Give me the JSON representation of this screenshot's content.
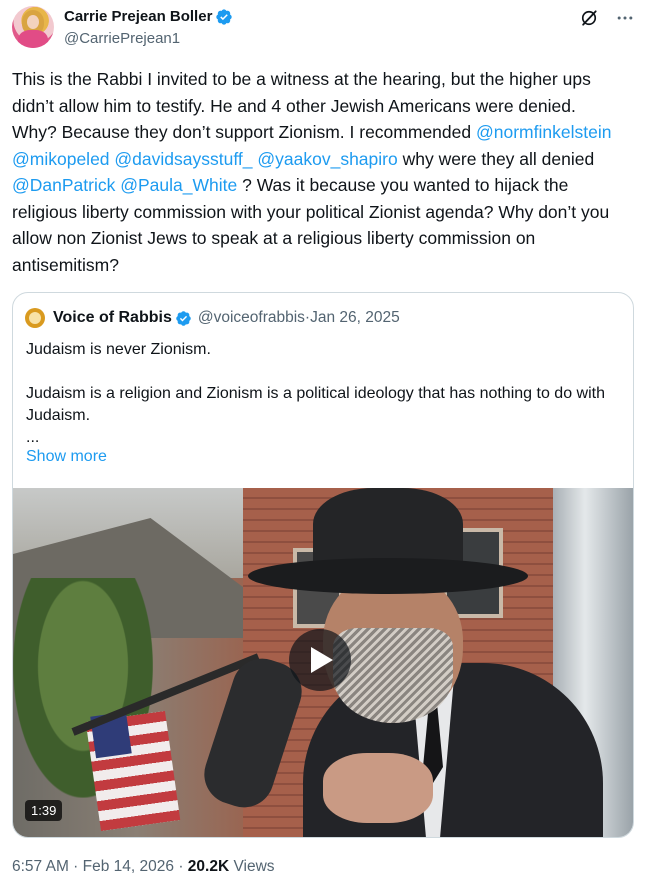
{
  "author": {
    "display_name": "Carrie Prejean Boller",
    "handle": "@CarriePrejean1",
    "verified": true,
    "avatar_icon": "profile-photo"
  },
  "top_actions": [
    {
      "name": "grok-icon"
    },
    {
      "name": "more-icon"
    }
  ],
  "tweet": {
    "text_parts": [
      {
        "text": "This is the Rabbi I invited to be a witness at the hearing, but the higher ups didn’t allow him to testify. He and 4 other Jewish Americans were denied. Why? Because they don’t support Zionism. I recommended ",
        "type": "text"
      },
      {
        "text": "@normfinkelstein",
        "type": "mention"
      },
      {
        "text": " ",
        "type": "text"
      },
      {
        "text": "@mikopeled",
        "type": "mention"
      },
      {
        "text": " ",
        "type": "text"
      },
      {
        "text": "@davidsaysstuff_",
        "type": "mention"
      },
      {
        "text": " ",
        "type": "text"
      },
      {
        "text": "@yaakov_shapiro",
        "type": "mention"
      },
      {
        "text": " why were they all denied ",
        "type": "text"
      },
      {
        "text": "@DanPatrick",
        "type": "mention"
      },
      {
        "text": " ",
        "type": "text"
      },
      {
        "text": "@Paula_White",
        "type": "mention"
      },
      {
        "text": " ? Was it because you wanted to hijack the religious liberty commission with your political Zionist agenda? Why don’t you allow non Zionist Jews to speak at a religious liberty commission on antisemitism?",
        "type": "text"
      }
    ]
  },
  "quote": {
    "display_name": "Voice of Rabbis",
    "handle": "@voiceofrabbis",
    "separator": " · ",
    "date": "Jan 26, 2025",
    "verified": true,
    "text": "Judaism is never Zionism.\n\nJudaism is a religion and Zionism is a political ideology that has nothing to do with Judaism.\n...",
    "show_more": "Show more",
    "video": {
      "duration": "1:39",
      "play_icon": "play-icon"
    }
  },
  "footer": {
    "time": "6:57 AM",
    "separator": " · ",
    "date": "Feb 14, 2026",
    "views_count": "20.2K",
    "views_label": "Views"
  },
  "colors": {
    "text": "#0f1419",
    "secondary": "#536471",
    "link": "#1d9bf0",
    "verified": "#1d9bf0",
    "border": "#cfd9de"
  }
}
